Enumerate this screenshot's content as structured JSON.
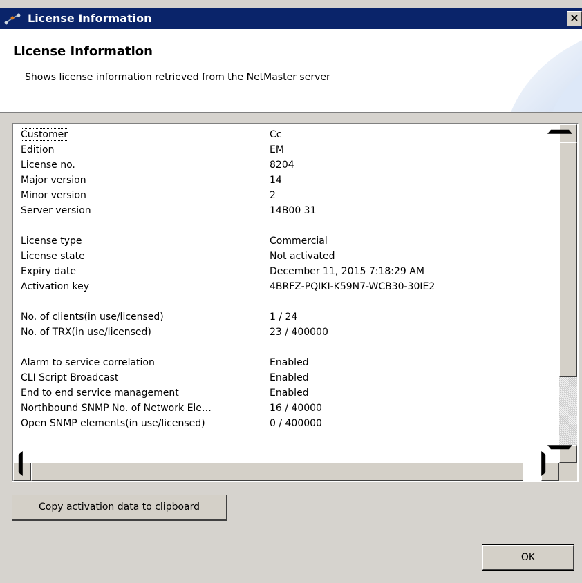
{
  "window": {
    "title": "License Information",
    "close_label": "×"
  },
  "header": {
    "title": "License Information",
    "description": "Shows license information retrieved from the NetMaster server"
  },
  "rows": [
    {
      "key": "Customer",
      "value": "Cc"
    },
    {
      "key": "Edition",
      "value": "EM"
    },
    {
      "key": "License no.",
      "value": "8204"
    },
    {
      "key": "Major version",
      "value": "14"
    },
    {
      "key": "Minor version",
      "value": "2"
    },
    {
      "key": "Server version",
      "value": "14B00 31"
    },
    {
      "key": "License type",
      "value": "Commercial"
    },
    {
      "key": "License state",
      "value": "Not activated"
    },
    {
      "key": "Expiry date",
      "value": "December 11, 2015 7:18:29 AM"
    },
    {
      "key": "Activation key",
      "value": "4BRFZ-PQIKI-K59N7-WCB30-30IE2"
    },
    {
      "key": "No. of clients(in use/licensed)",
      "value": "1 / 24"
    },
    {
      "key": "No. of TRX(in use/licensed)",
      "value": "23 / 400000"
    },
    {
      "key": "Alarm to service correlation",
      "value": "Enabled"
    },
    {
      "key": "CLI Script Broadcast",
      "value": "Enabled"
    },
    {
      "key": "End to end service management",
      "value": "Enabled"
    },
    {
      "key": "Northbound SNMP No. of Network Ele…",
      "value": "16 / 40000"
    },
    {
      "key": "Open SNMP elements(in use/licensed)",
      "value": "0 / 400000"
    }
  ],
  "buttons": {
    "copy_label": "Copy activation data to clipboard",
    "ok_label": "OK"
  },
  "icons": {
    "app": "network-node-icon",
    "close": "close-icon"
  },
  "colors": {
    "titlebar": "#0a246a",
    "dialog_bg": "#d6d3ce"
  }
}
